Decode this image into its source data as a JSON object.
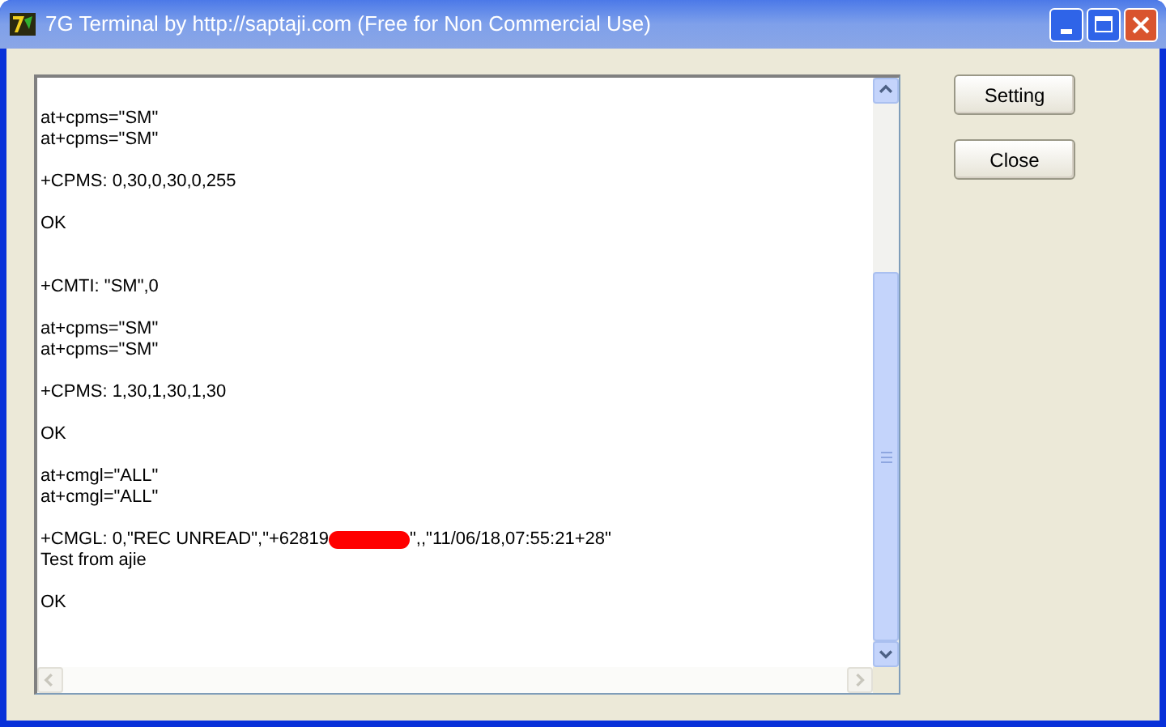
{
  "window": {
    "title": "7G Terminal by http://saptaji.com (Free for Non Commercial Use)"
  },
  "terminal": {
    "lines": [
      {
        "kind": "blank"
      },
      {
        "kind": "text",
        "text": "at+cpms=\"SM\""
      },
      {
        "kind": "text",
        "text": "at+cpms=\"SM\""
      },
      {
        "kind": "blank"
      },
      {
        "kind": "text",
        "text": "+CPMS: 0,30,0,30,0,255"
      },
      {
        "kind": "blank"
      },
      {
        "kind": "text",
        "text": "OK"
      },
      {
        "kind": "blank"
      },
      {
        "kind": "blank"
      },
      {
        "kind": "text",
        "text": "+CMTI: \"SM\",0"
      },
      {
        "kind": "blank"
      },
      {
        "kind": "text",
        "text": "at+cpms=\"SM\""
      },
      {
        "kind": "text",
        "text": "at+cpms=\"SM\""
      },
      {
        "kind": "blank"
      },
      {
        "kind": "text",
        "text": "+CPMS: 1,30,1,30,1,30"
      },
      {
        "kind": "blank"
      },
      {
        "kind": "text",
        "text": "OK"
      },
      {
        "kind": "blank"
      },
      {
        "kind": "text",
        "text": "at+cmgl=\"ALL\""
      },
      {
        "kind": "text",
        "text": "at+cmgl=\"ALL\""
      },
      {
        "kind": "blank"
      },
      {
        "kind": "redacted",
        "before": "+CMGL: 0,\"REC UNREAD\",\"+62819",
        "after": "\",,\"11/06/18,07:55:21+28\""
      },
      {
        "kind": "text",
        "text": "Test from ajie"
      },
      {
        "kind": "blank"
      },
      {
        "kind": "text",
        "text": "OK"
      }
    ]
  },
  "buttons": [
    {
      "label": "Setting"
    },
    {
      "label": "Close"
    }
  ]
}
